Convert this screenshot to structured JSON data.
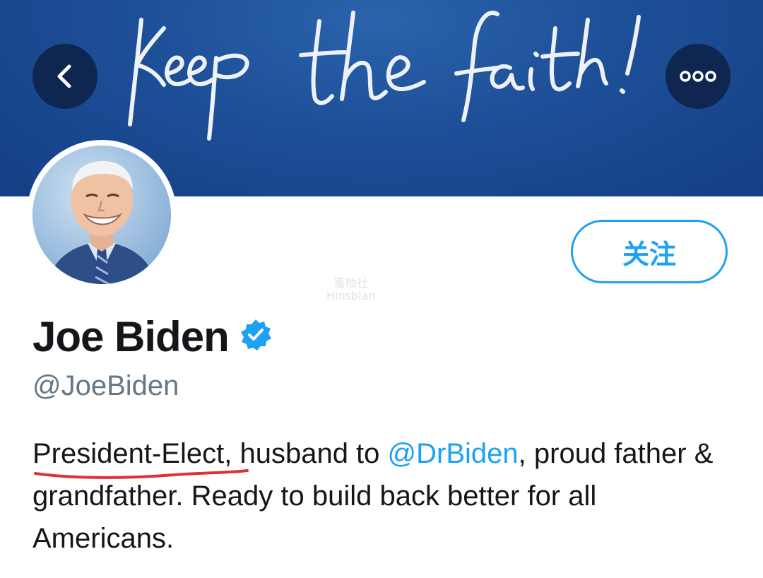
{
  "banner": {
    "handwriting_text": "keep the faith!",
    "colors": {
      "top": "#2b63ad",
      "bottom": "#143f84"
    }
  },
  "header": {
    "back_icon": "chevron-left-icon",
    "more_icon": "more-horizontal-icon"
  },
  "profile": {
    "name": "Joe Biden",
    "verified_icon": "verified-badge-icon",
    "handle": "@JoeBiden",
    "follow_label": "关注",
    "bio": {
      "emphasis": "President-Elect",
      "part1": ", husband to ",
      "mention": "@DrBiden",
      "part2": ", proud father & grandfather. Ready to build back better for all Americans."
    }
  },
  "watermark": {
    "line1": "蜜柚社",
    "line2": "Hinsbian"
  },
  "colors": {
    "accent": "#1da1f2",
    "text": "#14171a",
    "muted": "#657786",
    "annotation_underline": "#e0303a"
  }
}
